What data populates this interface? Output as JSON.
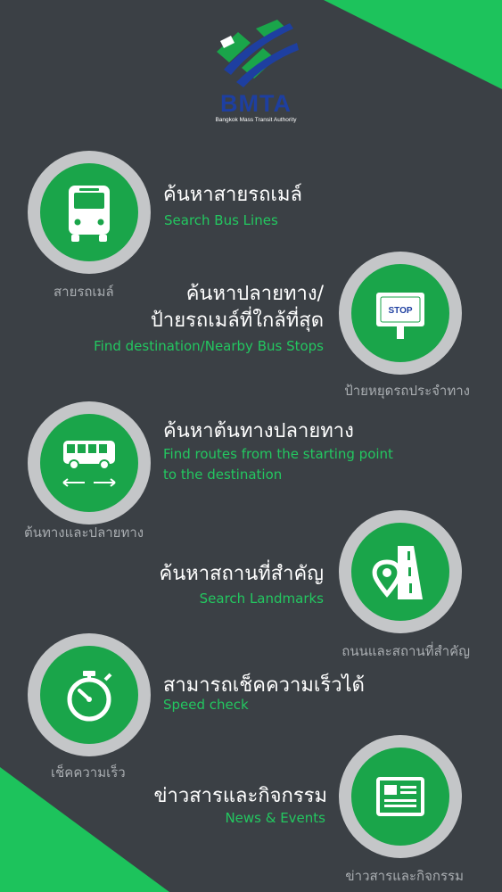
{
  "brand": {
    "logo_text": "BMTA",
    "logo_subtitle": "Bangkok Mass Transit Authority",
    "colors": {
      "background": "#3b4045",
      "accent": "#1dc35c",
      "circle_fill": "#1aa54a",
      "circle_ring": "#c4c6c8",
      "logo_blue": "#1e3fa0"
    }
  },
  "features": [
    {
      "icon": "bus-front-icon",
      "title": "ค้นหาสายรถเมล์",
      "subtitle": "Search Bus Lines",
      "caption": "สายรถเมล์"
    },
    {
      "icon": "bus-stop-sign-icon",
      "sign_text": "STOP",
      "title_line1": "ค้นหาปลายทาง/",
      "title_line2": "ป้ายรถเมล์ที่ใกล้ที่สุด",
      "subtitle": "Find destination/Nearby Bus Stops",
      "caption": "ป้ายหยุดรถประจำทาง"
    },
    {
      "icon": "bus-route-arrows-icon",
      "title": "ค้นหาต้นทางปลายทาง",
      "subtitle_line1": "Find routes from the starting point",
      "subtitle_line2": "to the destination",
      "caption": "ต้นทางและปลายทาง"
    },
    {
      "icon": "map-pin-road-icon",
      "title": "ค้นหาสถานที่สำคัญ",
      "subtitle": "Search Landmarks",
      "caption": "ถนนและสถานที่สำคัญ"
    },
    {
      "icon": "stopwatch-icon",
      "title": "สามารถเช็คความเร็วได้",
      "subtitle": "Speed check",
      "caption": "เช็คความเร็ว"
    },
    {
      "icon": "newspaper-icon",
      "title": "ข่าวสารและกิจกรรม",
      "subtitle": "News & Events",
      "caption": "ข่าวสารและกิจกรรม"
    }
  ]
}
